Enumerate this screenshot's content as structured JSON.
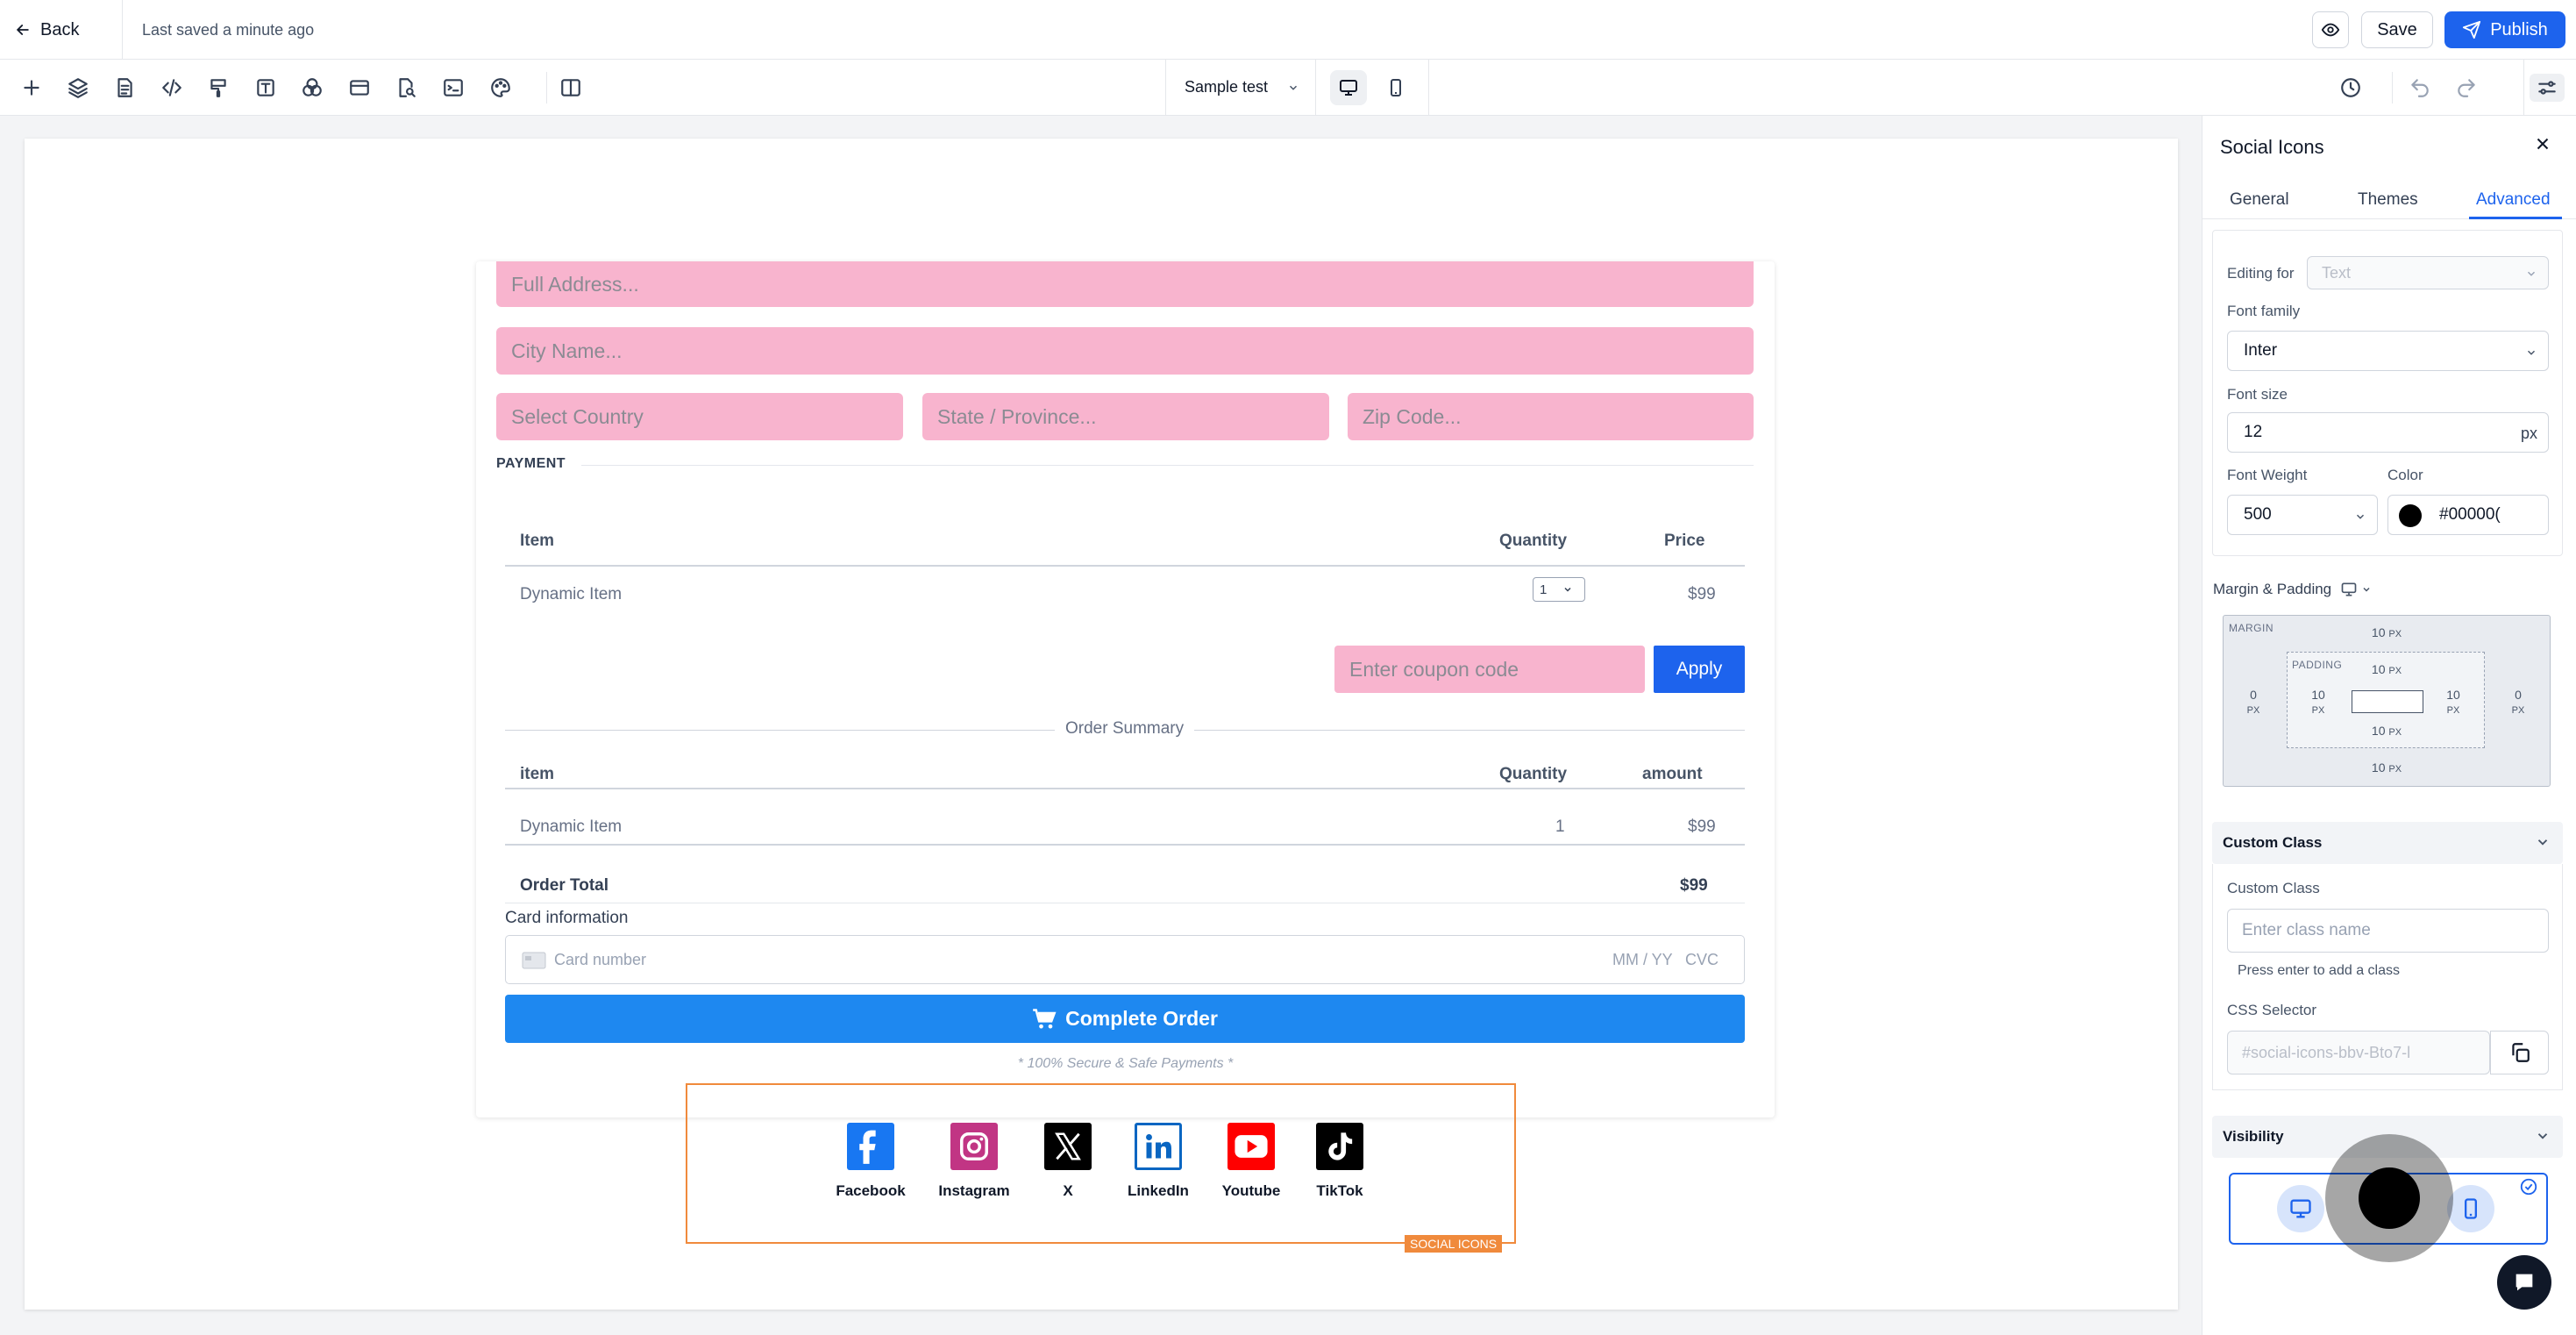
{
  "topbar": {
    "back_label": "Back",
    "saved_status": "Last saved a minute ago",
    "save_label": "Save",
    "publish_label": "Publish"
  },
  "toolbar": {
    "selected_page": "Sample test",
    "icons": [
      "add-icon",
      "layers-icon",
      "pages-icon",
      "code-icon",
      "paint-brush-icon",
      "text-style-icon",
      "color-blend-icon",
      "browser-window-icon",
      "page-search-icon",
      "terminal-icon",
      "palette-icon",
      "split-view-icon"
    ]
  },
  "form": {
    "address_placeholder": "Full Address...",
    "city_placeholder": "City Name...",
    "country_placeholder": "Select Country",
    "state_placeholder": "State / Province...",
    "zip_placeholder": "Zip Code...",
    "payment_heading": "PAYMENT",
    "items_table": {
      "headers": [
        "Item",
        "Quantity",
        "Price"
      ],
      "row": {
        "item": "Dynamic Item",
        "quantity": "1",
        "price": "$99"
      }
    },
    "coupon_placeholder": "Enter coupon code",
    "apply_label": "Apply",
    "order_summary_label": "Order Summary",
    "summary_table": {
      "headers": [
        "item",
        "Quantity",
        "amount"
      ],
      "row": {
        "item": "Dynamic Item",
        "quantity": "1",
        "amount": "$99"
      },
      "total_label": "Order Total",
      "total_value": "$99"
    },
    "card_info_label": "Card information",
    "card_number_placeholder": "Card number",
    "card_expiry_placeholder": "MM / YY",
    "card_cvc_placeholder": "CVC",
    "complete_order_label": "Complete Order",
    "secure_note": "* 100% Secure & Safe Payments *"
  },
  "social": {
    "badge": "SOCIAL ICONS",
    "items": [
      {
        "name": "Facebook",
        "color": "#1877f2"
      },
      {
        "name": "Instagram",
        "color": "#c13584"
      },
      {
        "name": "X",
        "color": "#000000"
      },
      {
        "name": "LinkedIn",
        "color": "#0a66c2"
      },
      {
        "name": "Youtube",
        "color": "#ff0000"
      },
      {
        "name": "TikTok",
        "color": "#000000"
      }
    ]
  },
  "panel": {
    "title": "Social Icons",
    "tabs": [
      "General",
      "Themes",
      "Advanced"
    ],
    "active_tab": "Advanced",
    "editing_for_label": "Editing for",
    "editing_for_value": "Text",
    "font_family_label": "Font family",
    "font_family_value": "Inter",
    "font_size_label": "Font size",
    "font_size_value": "12",
    "font_size_unit": "px",
    "font_weight_label": "Font Weight",
    "font_weight_value": "500",
    "color_label": "Color",
    "color_value": "#00000(",
    "margin_padding_label": "Margin & Padding",
    "margin_label": "MARGIN",
    "padding_label": "PADDING",
    "margin": {
      "top": "10",
      "right": "0",
      "bottom": "10",
      "left": "0"
    },
    "padding": {
      "top": "10",
      "right": "10",
      "bottom": "10",
      "left": "10"
    },
    "unit": "PX",
    "custom_class_section": "Custom Class",
    "custom_class_label": "Custom Class",
    "custom_class_placeholder": "Enter class name",
    "custom_class_hint": "Press enter to add a class",
    "css_selector_label": "CSS Selector",
    "css_selector_value": "#social-icons-bbv-Bto7-l",
    "visibility_section": "Visibility"
  },
  "colors": {
    "primary": "#1d63ed",
    "complete_order": "#1e88f0",
    "pink_field": "#f8b4ce",
    "selection_orange": "#f08a3c"
  }
}
